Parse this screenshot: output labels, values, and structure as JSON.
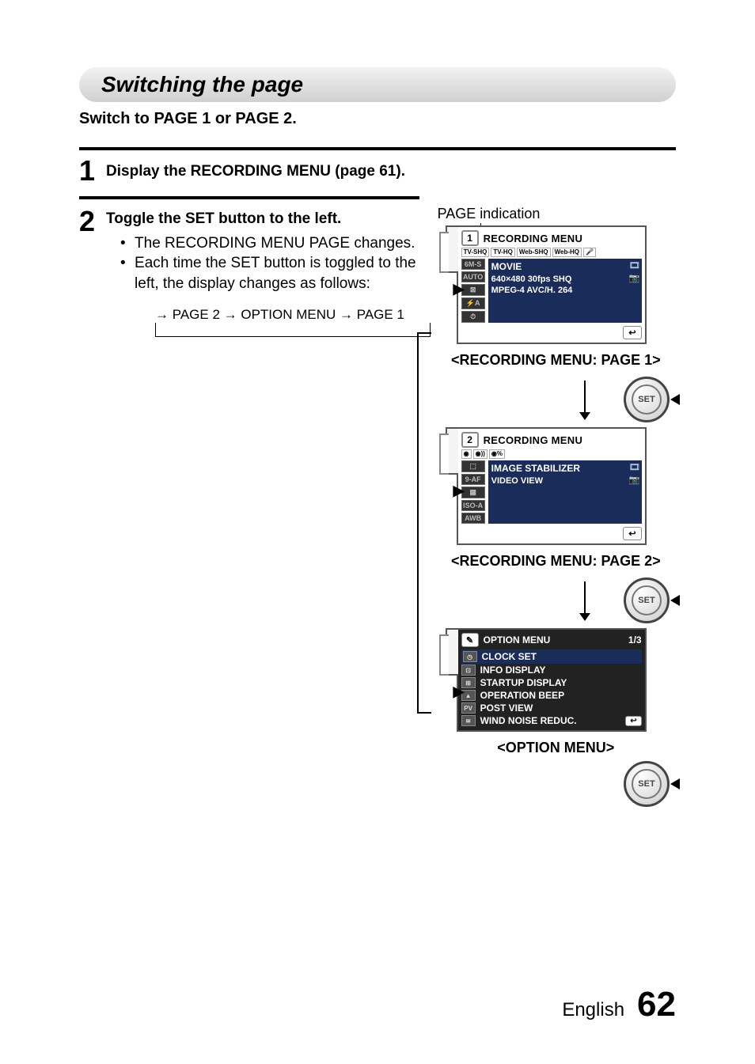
{
  "title": "Switching the page",
  "subtitle": "Switch to PAGE 1 or PAGE 2.",
  "step1": {
    "num": "1",
    "text": "Display the RECORDING MENU (page 61)."
  },
  "step2": {
    "num": "2",
    "heading": "Toggle the SET button to the left.",
    "bullet1": "The RECORDING MENU PAGE changes.",
    "bullet2": "Each time the SET button is toggled to the left, the display changes as follows:",
    "cycle": "→ PAGE 2 → OPTION MENU → PAGE 1"
  },
  "page_indication_label": "PAGE indication",
  "screen1": {
    "page_chip": "1",
    "title": "RECORDING MENU",
    "modes": [
      "TV-SHQ",
      "TV-HQ",
      "Web-SHQ",
      "Web-HQ",
      "🎤"
    ],
    "left_icons": [
      "6M-S",
      "AUTO",
      "⊠",
      "⚡A",
      "⏱"
    ],
    "hl_line1": "MOVIE",
    "hl_line2": "640×480 30fps SHQ",
    "hl_line3": "MPEG-4 AVC/H. 264"
  },
  "caption1": "<RECORDING MENU: PAGE 1>",
  "screen2": {
    "page_chip": "2",
    "title": "RECORDING MENU",
    "modes": [
      "◉",
      "◉))",
      "◉%"
    ],
    "left_icons": [
      "⬚",
      "9-AF",
      "▦",
      "ISO-A",
      "AWB"
    ],
    "hl_line1": "IMAGE STABILIZER",
    "hl_line2": "VIDEO VIEW"
  },
  "caption2": "<RECORDING MENU: PAGE 2>",
  "screen3": {
    "tool_icon": "✎",
    "title": "OPTION MENU",
    "page": "1/3",
    "rows": [
      {
        "icon": "◷",
        "text": "CLOCK SET",
        "selected": true
      },
      {
        "icon": "⊡",
        "text": "INFO DISPLAY",
        "selected": false
      },
      {
        "icon": "⊞",
        "text": "STARTUP DISPLAY",
        "selected": false
      },
      {
        "icon": "▲",
        "text": "OPERATION BEEP",
        "selected": false
      },
      {
        "icon": "PV",
        "text": "POST VIEW",
        "selected": false
      },
      {
        "icon": "≋",
        "text": "WIND NOISE REDUC.",
        "selected": false
      }
    ]
  },
  "caption3": "<OPTION MENU>",
  "set_label": "SET",
  "return_chip": "↩",
  "footer": {
    "lang": "English",
    "page": "62"
  }
}
